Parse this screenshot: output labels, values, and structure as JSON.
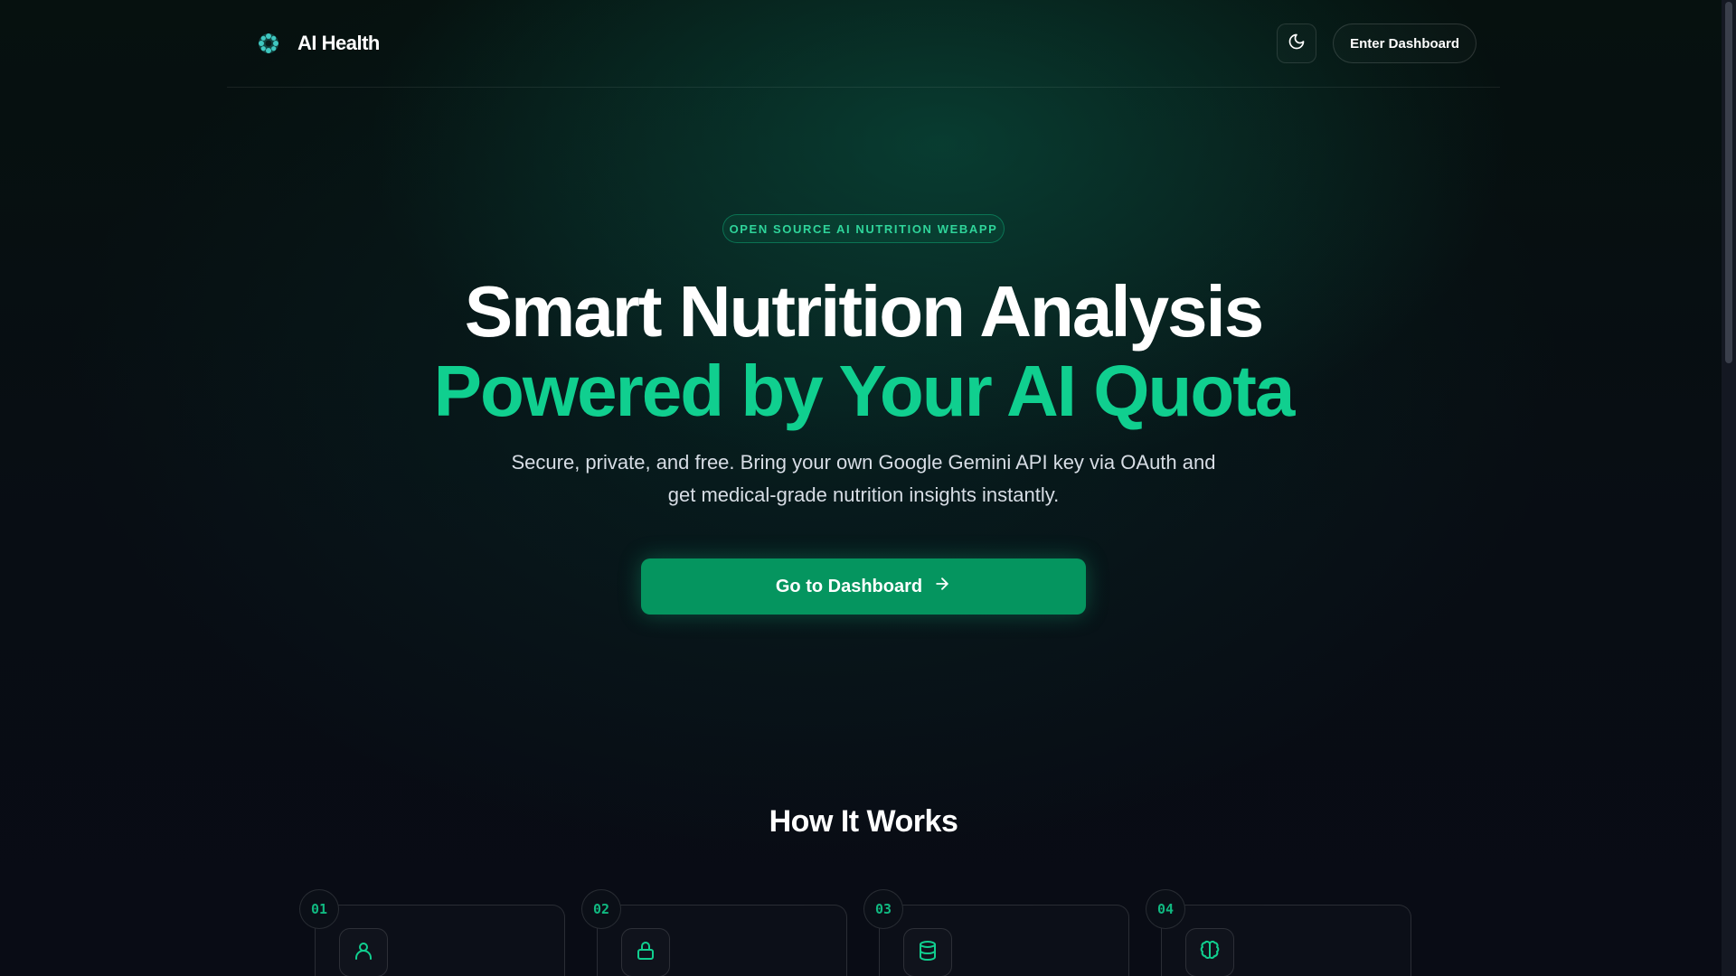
{
  "header": {
    "brand_name": "AI Health",
    "enter_button": "Enter Dashboard",
    "theme_icon": "moon-icon"
  },
  "hero": {
    "badge": "OPEN SOURCE AI NUTRITION WEBAPP",
    "title_line1": "Smart Nutrition Analysis",
    "title_line2": "Powered by Your AI Quota",
    "subtitle_line1": "Secure, private, and free. Bring your own Google Gemini API key via OAuth and",
    "subtitle_line2": "get medical-grade nutrition insights instantly.",
    "cta_label": "Go to Dashboard",
    "cta_icon": "arrow-right-icon"
  },
  "how_it_works": {
    "title": "How It Works",
    "steps": [
      {
        "number": "01",
        "icon": "user-icon"
      },
      {
        "number": "02",
        "icon": "lock-icon"
      },
      {
        "number": "03",
        "icon": "database-icon"
      },
      {
        "number": "04",
        "icon": "brain-icon"
      }
    ]
  },
  "colors": {
    "accent": "#10cf8f",
    "cta_bg": "#05955f",
    "background": "#080b12"
  }
}
